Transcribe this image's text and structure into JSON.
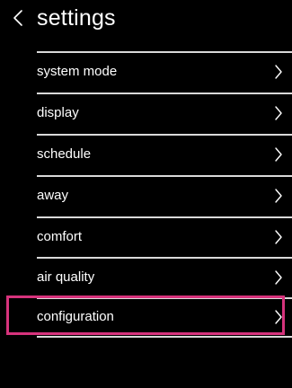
{
  "header": {
    "back_icon": "chevron-left-icon",
    "title": "settings"
  },
  "menu": {
    "items": [
      {
        "label": "system mode",
        "icon": "chevron-right-icon"
      },
      {
        "label": "display",
        "icon": "chevron-right-icon"
      },
      {
        "label": "schedule",
        "icon": "chevron-right-icon"
      },
      {
        "label": "away",
        "icon": "chevron-right-icon"
      },
      {
        "label": "comfort",
        "icon": "chevron-right-icon"
      },
      {
        "label": "air quality",
        "icon": "chevron-right-icon"
      },
      {
        "label": "configuration",
        "icon": "chevron-right-icon",
        "highlighted": true
      }
    ]
  },
  "colors": {
    "background": "#000000",
    "text": "#ffffff",
    "divider": "#d9d9d9",
    "highlight": "#d6337c"
  }
}
